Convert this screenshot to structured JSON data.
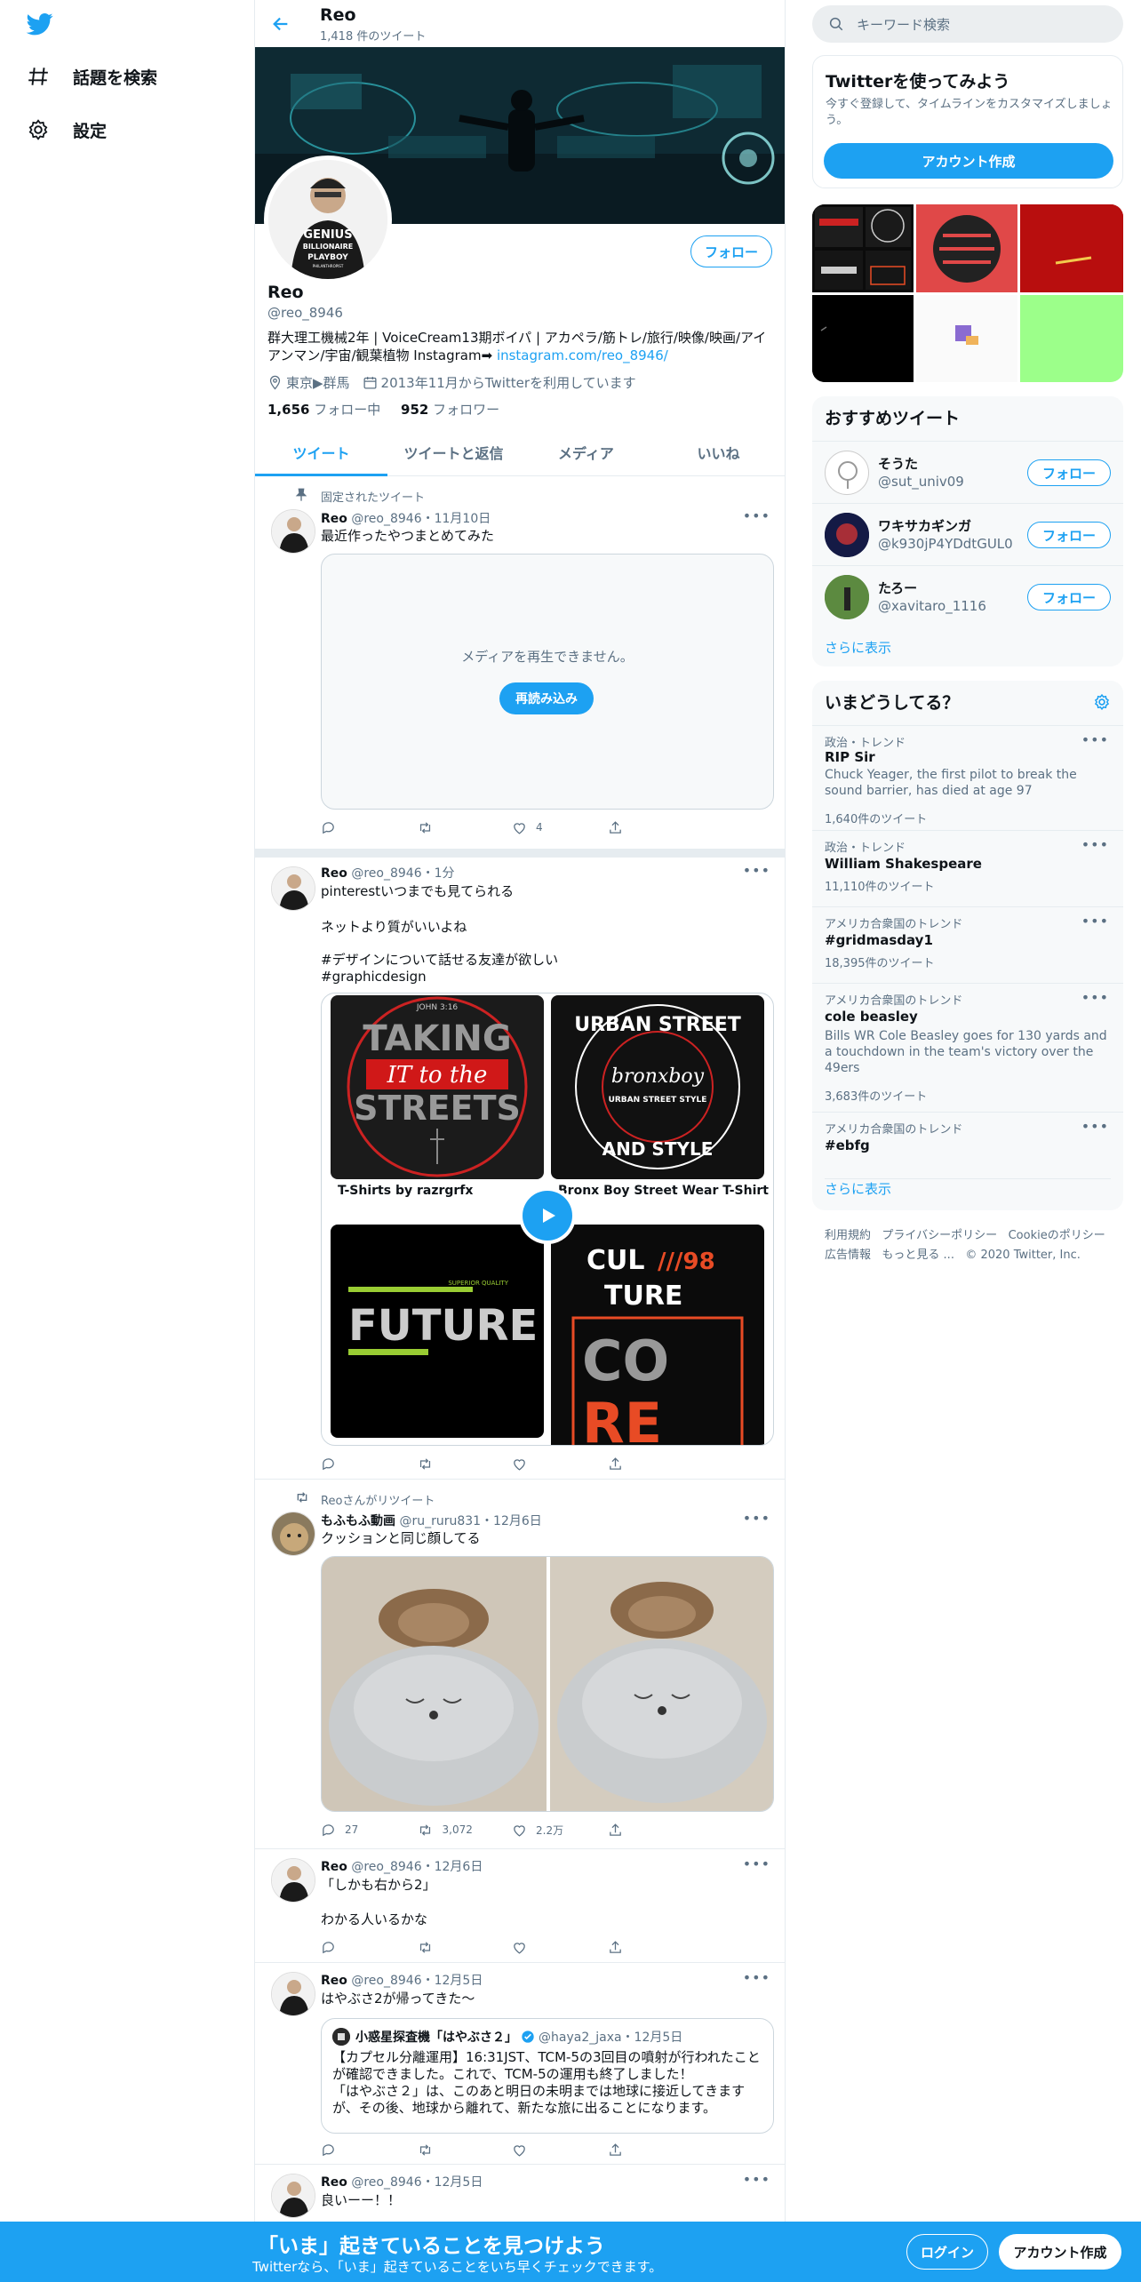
{
  "nav": {
    "explore": "話題を検索",
    "settings": "設定"
  },
  "header": {
    "name": "Reo",
    "tweet_count": "1,418 件のツイート"
  },
  "profile": {
    "name": "Reo",
    "handle": "@reo_8946",
    "follow": "フォロー",
    "bio_text": "群大理工機械2年 | VoiceCream13期ボイパ | アカペラ/筋トレ/旅行/映像/映画/アイアンマン/宇宙/観葉植物 Instagram➡ ",
    "bio_link": "instagram.com/reo_8946/",
    "location": "東京▶群馬",
    "joined": "2013年11月からTwitterを利用しています",
    "following_count": "1,656",
    "following_label": "フォロー中",
    "followers_count": "952",
    "followers_label": "フォロワー",
    "shirt_lines": [
      "GENIUS",
      "BILLIONAIRE",
      "PLAYBOY",
      "PHILANTHROPIST"
    ]
  },
  "tabs": [
    "ツイート",
    "ツイートと返信",
    "メディア",
    "いいね"
  ],
  "tweets": {
    "t1": {
      "pinned": "固定されたツイート",
      "name": "Reo",
      "meta": "@reo_8946・11月10日",
      "text": "最近作ったやつまとめてみた",
      "media_error": "メディアを再生できません。",
      "reload": "再読み込み",
      "likes": "4"
    },
    "t2": {
      "name": "Reo",
      "meta": "@reo_8946・1分",
      "line1": "pinterestいつまでも見てられる",
      "line2": "ネットより質がいいよね",
      "tag1": "#デザインについて話せる友達が欲しい",
      "tag2": "#graphicdesign",
      "captions": [
        "T-Shirts by razrgrfx",
        "Bronx Boy Street Wear T-Shirt"
      ],
      "img1_lines": [
        "JOHN 3:16",
        "TAKING",
        "IT to the",
        "STREETS"
      ],
      "img2_lines": [
        "URBAN STREET",
        "bronxboy",
        "URBAN STREET STYLE",
        "AND STYLE"
      ],
      "img3_lines": [
        "SUPERIOR QUALITY",
        "FUTURE"
      ],
      "img4_lines": [
        "CUL",
        "///98",
        "TURE",
        "CO",
        "RE"
      ]
    },
    "t3": {
      "retweeted_by": "Reoさんがリツイート",
      "name": "もふもふ動画",
      "meta": "@ru_ruru831・12月6日",
      "text": "クッションと同じ顔してる",
      "replies": "27",
      "retweets": "3,072",
      "likes": "2.2万"
    },
    "t4": {
      "name": "Reo",
      "meta": "@reo_8946・12月6日",
      "line1": "「しかも右から2」",
      "line2": "わかる人いるかな"
    },
    "t5": {
      "name": "Reo",
      "meta": "@reo_8946・12月5日",
      "text": "はやぶさ2が帰ってきた〜",
      "quote_name": "小惑星探査機「はやぶさ２」",
      "quote_meta": "@haya2_jaxa・12月5日",
      "quote_text": "【カプセル分離運用】16:31JST、TCM-5の3回目の噴射が行われたことが確認できました。これで、TCM-5の運用も終了しました！\n「はやぶさ２」は、このあと明日の未明までは地球に接近してきますが、その後、地球から離れて、新たな旅に出ることになります。"
    },
    "t6": {
      "name": "Reo",
      "meta": "@reo_8946・12月5日",
      "text": "良いーー！！"
    }
  },
  "right": {
    "search_placeholder": "キーワード検索",
    "signup_title": "Twitterを使ってみよう",
    "signup_desc": "今すぐ登録して、タイムラインをカスタマイズしましょう。",
    "signup_button": "アカウント作成",
    "recommend_title": "おすすめツイート",
    "users": [
      {
        "name": "そうた",
        "handle": "@sut_univ09"
      },
      {
        "name": "ワキサカギンガ",
        "handle": "@k930jP4YDdtGUL0"
      },
      {
        "name": "たろー",
        "handle": "@xavitaro_1116"
      }
    ],
    "follow": "フォロー",
    "show_more": "さらに表示",
    "trends_title": "いまどうしてる？",
    "trends": [
      {
        "context": "政治・トレンド",
        "title": "RIP Sir",
        "desc": "Chuck Yeager, the first pilot to break the sound barrier, has died at age 97",
        "count": "1,640件のツイート"
      },
      {
        "context": "政治・トレンド",
        "title": "William Shakespeare",
        "desc": "",
        "count": "11,110件のツイート"
      },
      {
        "context": "アメリカ合衆国のトレンド",
        "title": "#gridmasday1",
        "desc": "",
        "count": "18,395件のツイート"
      },
      {
        "context": "アメリカ合衆国のトレンド",
        "title": "cole beasley",
        "desc": "Bills WR Cole Beasley goes for 130 yards and a touchdown in the team's victory over the 49ers",
        "count": "3,683件のツイート"
      },
      {
        "context": "アメリカ合衆国のトレンド",
        "title": "#ebfg",
        "desc": "",
        "count": ""
      }
    ],
    "footer_line1": [
      "利用規約",
      "プライバシーポリシー",
      "Cookieのポリシー"
    ],
    "footer_line2": [
      "広告情報",
      "もっと見る ...",
      "© 2020 Twitter, Inc."
    ]
  },
  "bottombar": {
    "title": "「いま」起きていることを見つけよう",
    "subtitle": "Twitterなら、「いま」起きていることをいち早くチェックできます。",
    "login": "ログイン",
    "signup": "アカウント作成"
  },
  "colors": {
    "accent": "#1da1f2",
    "border": "#e6ecf0",
    "secondary_text": "#5b7083"
  }
}
